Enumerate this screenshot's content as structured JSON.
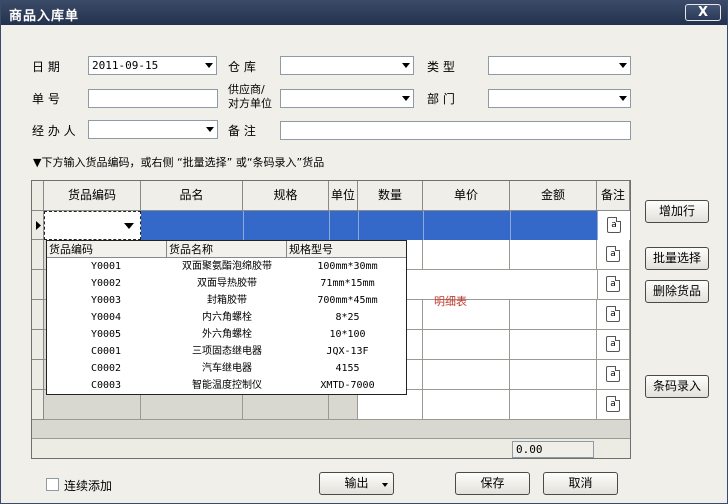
{
  "window": {
    "title": "商品入库单",
    "close_label": "X"
  },
  "form": {
    "date": {
      "label": "日   期",
      "value": "2011-09-15"
    },
    "warehouse": {
      "label": "仓   库",
      "value": ""
    },
    "type": {
      "label": "类   型",
      "value": ""
    },
    "doc_no": {
      "label": "单   号",
      "value": ""
    },
    "supplier": {
      "label_line1": "供应商/",
      "label_line2": "对方单位",
      "value": ""
    },
    "department": {
      "label": "部   门",
      "value": ""
    },
    "handler": {
      "label": "经 办 人",
      "value": ""
    },
    "remark": {
      "label": "备   注",
      "value": ""
    }
  },
  "hint": "▼下方输入货品编码，或右侧 “批量选择” 或“条码录入”货品",
  "grid": {
    "columns": [
      "货品编码",
      "品名",
      "规格",
      "单位",
      "数量",
      "单价",
      "金额",
      "备注"
    ],
    "note_icon": "a",
    "total_amount": "0.00",
    "watermark": "明细表"
  },
  "dropdown": {
    "columns": [
      "货品编码",
      "货品名称",
      "规格型号"
    ],
    "rows": [
      {
        "code": "Y0001",
        "name": "双面聚氨酯泡绵胶带",
        "spec": "100mm*30mm"
      },
      {
        "code": "Y0002",
        "name": "双面导热胶带",
        "spec": "71mm*15mm"
      },
      {
        "code": "Y0003",
        "name": "封箱胶带",
        "spec": "700mm*45mm"
      },
      {
        "code": "Y0004",
        "name": "内六角螺栓",
        "spec": "8*25"
      },
      {
        "code": "Y0005",
        "name": "外六角螺栓",
        "spec": "10*100"
      },
      {
        "code": "C0001",
        "name": "三项固态继电器",
        "spec": "JQX-13F"
      },
      {
        "code": "C0002",
        "name": "汽车继电器",
        "spec": "4155"
      },
      {
        "code": "C0003",
        "name": "智能温度控制仪",
        "spec": "XMTD-7000"
      }
    ]
  },
  "side_buttons": {
    "add_row": "增加行",
    "batch_select": "批量选择",
    "delete_item": "删除货品",
    "barcode_entry": "条码录入"
  },
  "bottom": {
    "continuous_add": "连续添加",
    "export": "输出",
    "save": "保存",
    "cancel": "取消"
  }
}
